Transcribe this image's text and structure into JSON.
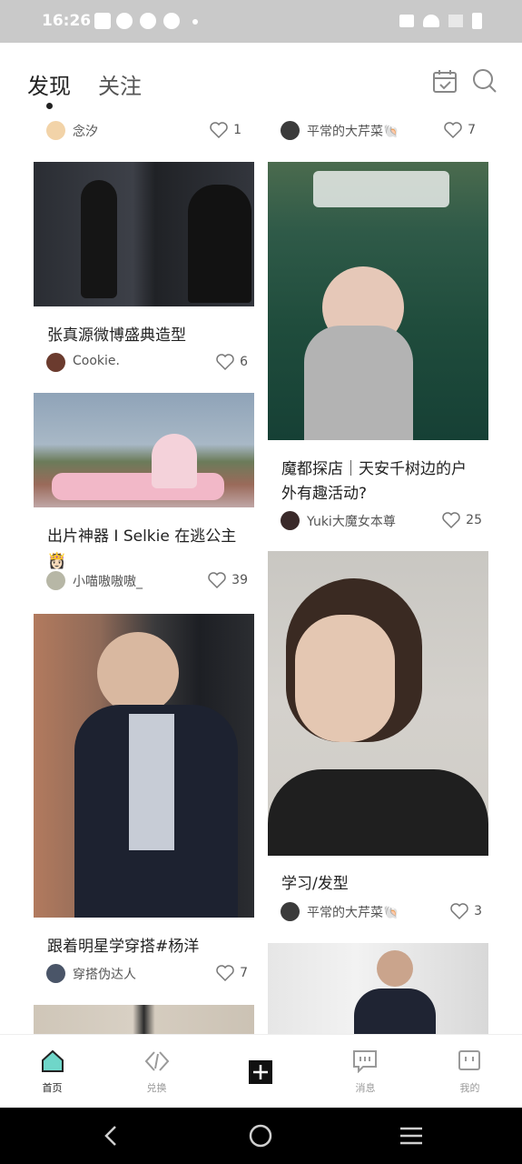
{
  "status_bar": {
    "time": "16:26"
  },
  "header": {
    "tabs": [
      "发现",
      "关注"
    ],
    "active_tab": 0,
    "icons": [
      "calendar-icon",
      "search-icon"
    ]
  },
  "feed": {
    "top_row": [
      {
        "author": "念汐",
        "likes": "1"
      },
      {
        "author": "平常的大芹菜🐚",
        "likes": "7"
      }
    ],
    "left_column": [
      {
        "title": "张真源微博盛典造型",
        "author": "Cookie.",
        "likes": "6"
      },
      {
        "title": "出片神器 I Selkie 在逃公主👸🏻",
        "author": "小喵嗷嗷嗷_",
        "likes": "39"
      },
      {
        "title": "跟着明星学穿搭#杨洋",
        "author": "穿搭伪达人",
        "likes": "7"
      }
    ],
    "right_column": [
      {
        "title": "魔都探店｜天安千树边的户外有趣活动?",
        "author": "Yuki大魔女本尊",
        "likes": "25"
      },
      {
        "title": "学习/发型",
        "author": "平常的大芹菜🐚",
        "likes": "3"
      }
    ]
  },
  "tab_bar": {
    "items": [
      {
        "label": "首页",
        "icon": "home-icon",
        "active": true
      },
      {
        "label": "兑换",
        "icon": "exchange-icon",
        "active": false
      },
      {
        "label": "",
        "icon": "plus-icon",
        "active": false
      },
      {
        "label": "消息",
        "icon": "message-icon",
        "active": false
      },
      {
        "label": "我的",
        "icon": "profile-icon",
        "active": false
      }
    ]
  },
  "nav_bar": {
    "icons": [
      "back-icon",
      "home-circle-icon",
      "recents-icon"
    ]
  }
}
